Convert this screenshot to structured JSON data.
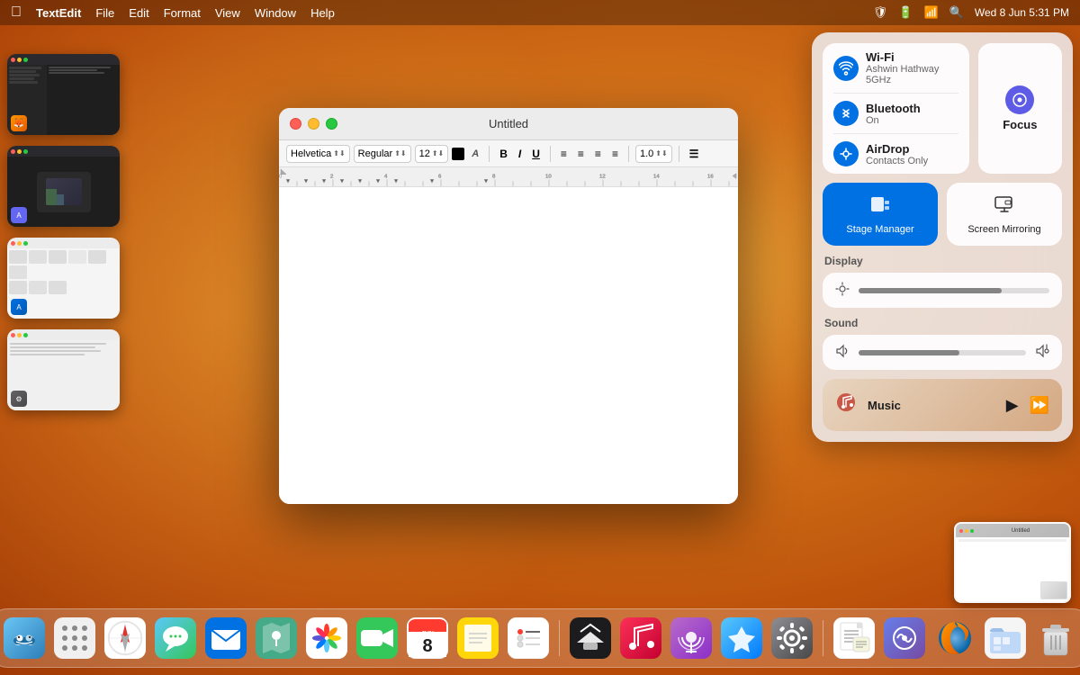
{
  "menubar": {
    "apple_icon": "🍎",
    "app_name": "TextEdit",
    "menus": [
      "File",
      "Edit",
      "Format",
      "View",
      "Window",
      "Help"
    ],
    "right_items": [
      "shield_icon",
      "battery_icon",
      "wifi_icon",
      "search_icon",
      "date_time"
    ],
    "date_time": "Wed 8 Jun  5:31 PM"
  },
  "textedit_window": {
    "title": "Untitled",
    "font": "Helvetica",
    "style": "Regular",
    "size": "12",
    "line_spacing": "1.0"
  },
  "control_center": {
    "wifi": {
      "label": "Wi-Fi",
      "sublabel": "Ashwin Hathway 5GHz"
    },
    "bluetooth": {
      "label": "Bluetooth",
      "sublabel": "On"
    },
    "airdrop": {
      "label": "AirDrop",
      "sublabel": "Contacts Only"
    },
    "focus": {
      "label": "Focus"
    },
    "stage_manager": {
      "label": "Stage Manager"
    },
    "screen_mirroring": {
      "label": "Screen Mirroring"
    },
    "display": {
      "label": "Display",
      "brightness": 75
    },
    "sound": {
      "label": "Sound",
      "volume": 60
    },
    "music": {
      "label": "Music",
      "playing": false
    }
  },
  "dock": {
    "items": [
      {
        "name": "Finder",
        "emoji": "🔵"
      },
      {
        "name": "Launchpad",
        "emoji": "🚀"
      },
      {
        "name": "Safari",
        "emoji": "🧭"
      },
      {
        "name": "Messages",
        "emoji": "💬"
      },
      {
        "name": "Mail",
        "emoji": "✉️"
      },
      {
        "name": "Maps",
        "emoji": "🗺"
      },
      {
        "name": "Photos",
        "emoji": "🌸"
      },
      {
        "name": "FaceTime",
        "emoji": "📹"
      },
      {
        "name": "Calendar",
        "emoji": "📅"
      },
      {
        "name": "Notes",
        "emoji": "📝"
      },
      {
        "name": "Reminders",
        "emoji": "☑️"
      },
      {
        "name": "Apple TV",
        "emoji": "📺"
      },
      {
        "name": "Music",
        "emoji": "🎵"
      },
      {
        "name": "Podcasts",
        "emoji": "🎙"
      },
      {
        "name": "App Store",
        "emoji": "🅰"
      },
      {
        "name": "System Preferences",
        "emoji": "⚙️"
      },
      {
        "name": "TextEdit",
        "emoji": "📄"
      },
      {
        "name": "Proxyman",
        "emoji": "🔮"
      },
      {
        "name": "Firefox",
        "emoji": "🦊"
      },
      {
        "name": "Files",
        "emoji": "📁"
      },
      {
        "name": "Trash",
        "emoji": "🗑"
      }
    ]
  }
}
